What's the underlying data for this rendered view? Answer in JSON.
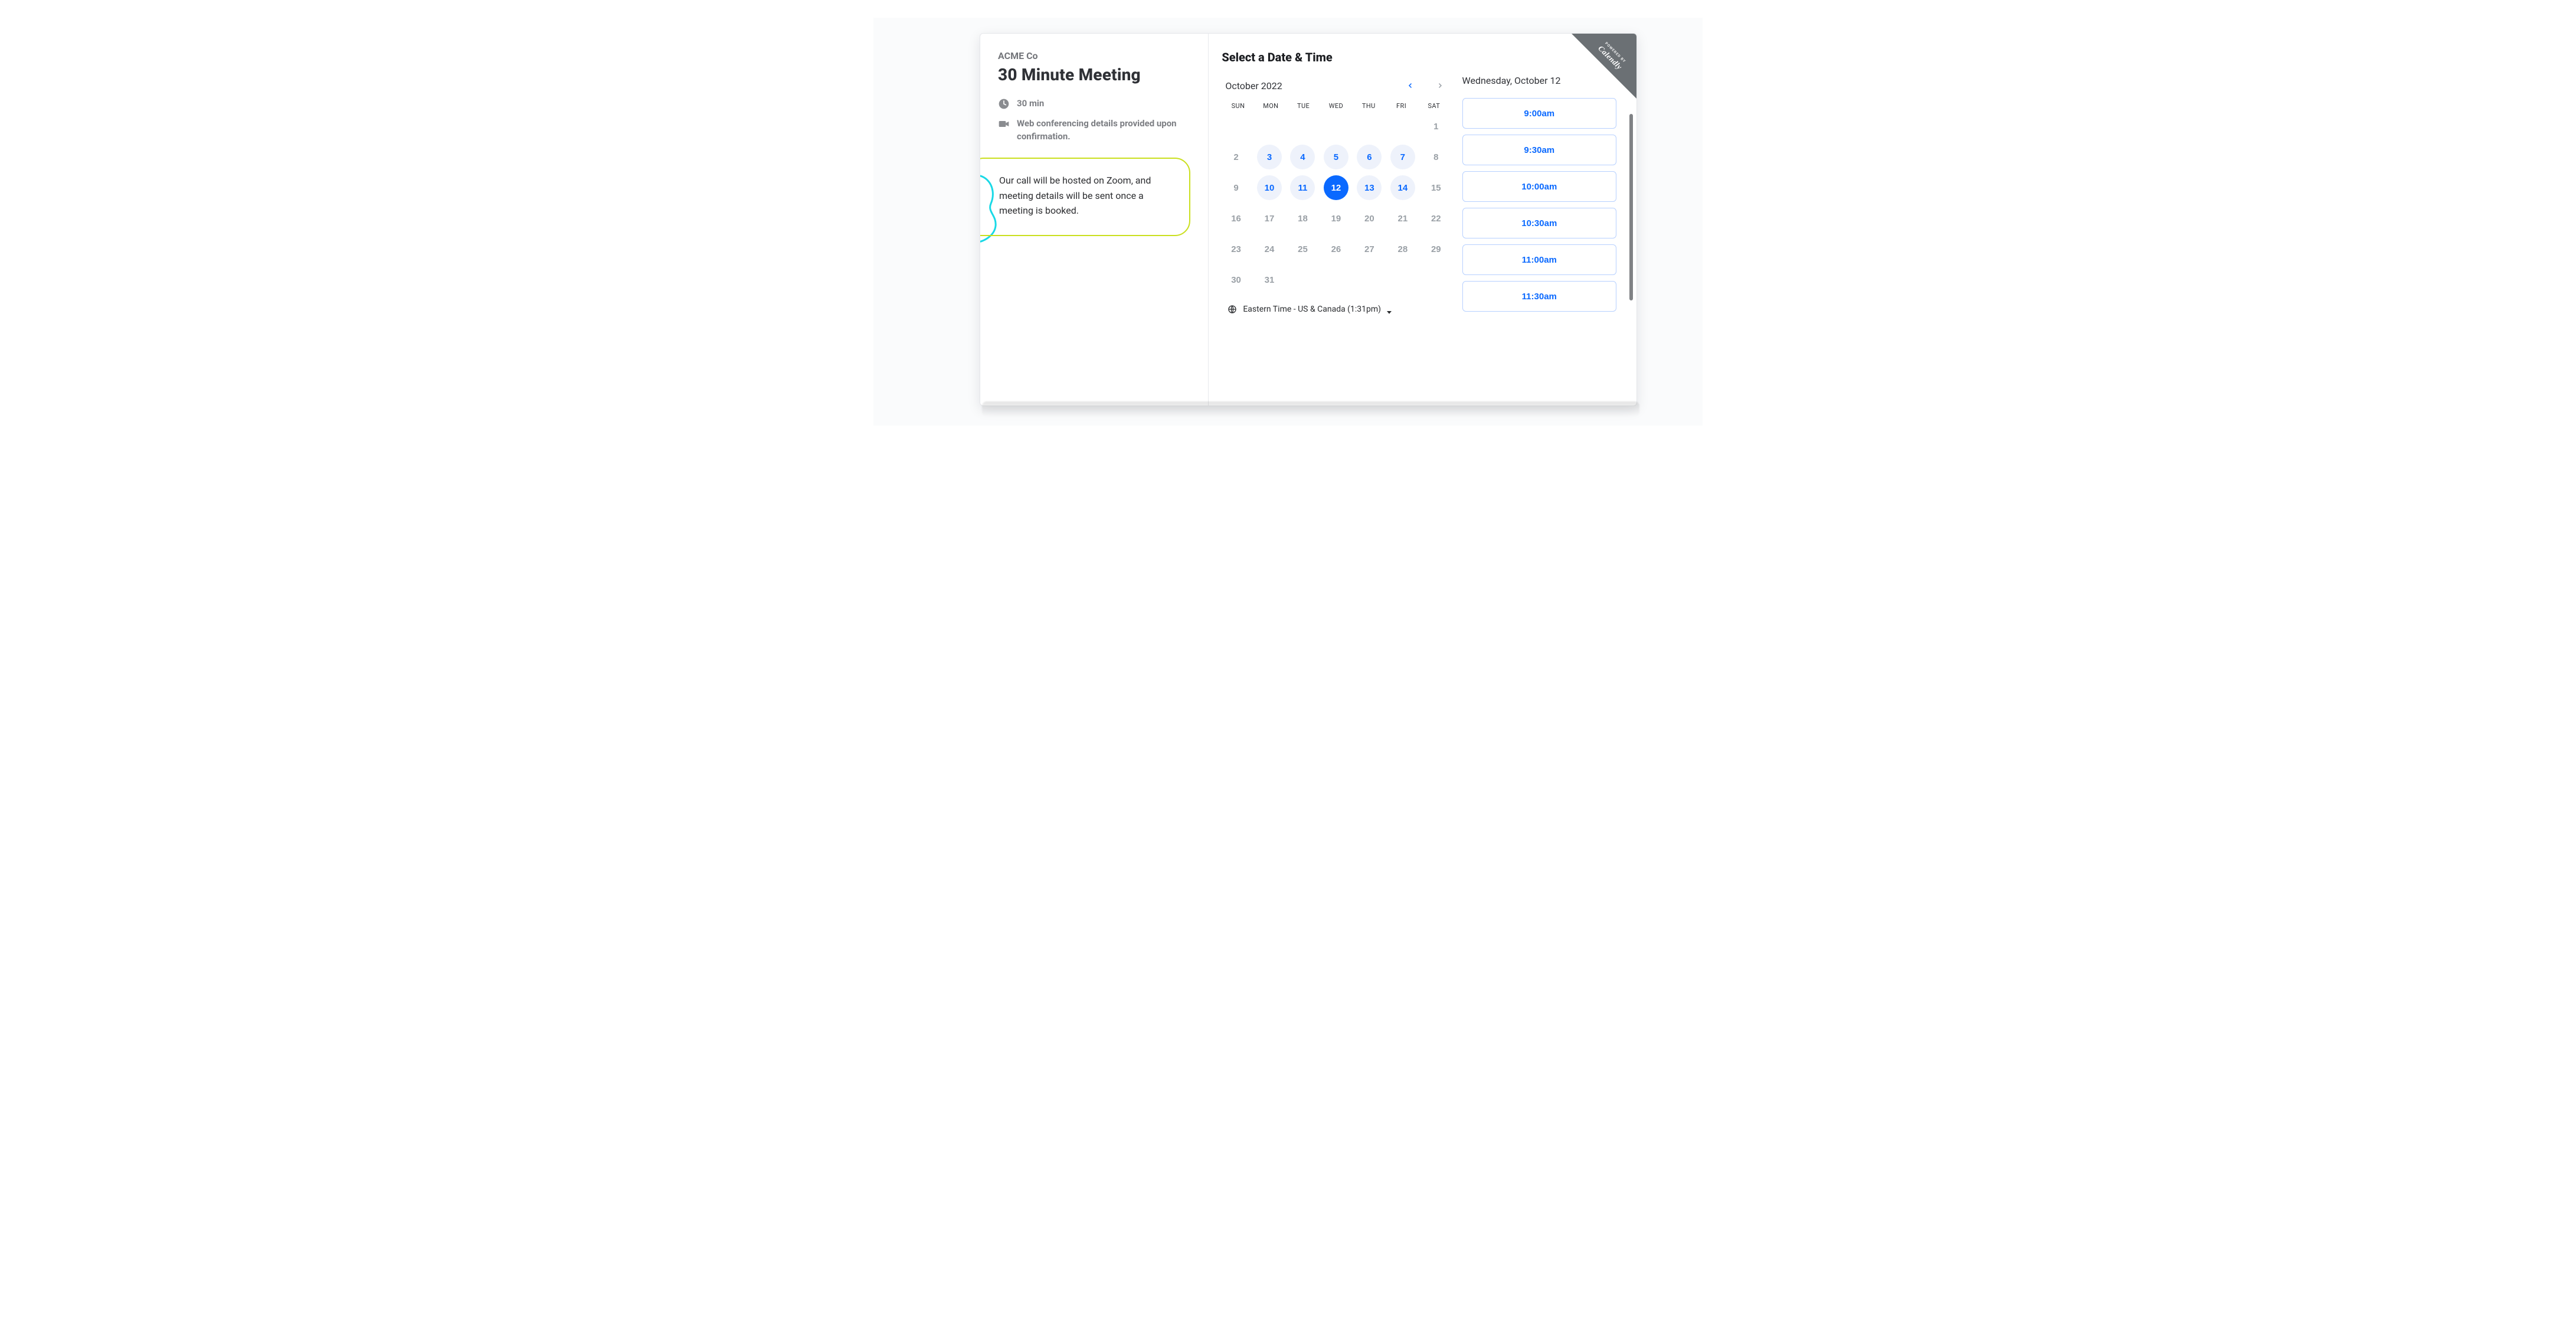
{
  "ribbon": {
    "powered_by": "POWERED BY",
    "brand": "Calendly"
  },
  "left": {
    "org": "ACME Co",
    "title": "30 Minute Meeting",
    "duration": "30 min",
    "conf_note": "Web conferencing details provided upon confirmation.",
    "description": "Our call will be hosted on Zoom, and meeting details will be sent once a meeting is booked."
  },
  "calendar": {
    "select_title": "Select a Date & Time",
    "month_label": "October 2022",
    "dow": [
      "SUN",
      "MON",
      "TUE",
      "WED",
      "THU",
      "FRI",
      "SAT"
    ],
    "leading_blanks": 6,
    "days": [
      {
        "n": 1,
        "state": "muted"
      },
      {
        "n": 2,
        "state": "muted"
      },
      {
        "n": 3,
        "state": "avail"
      },
      {
        "n": 4,
        "state": "avail"
      },
      {
        "n": 5,
        "state": "avail"
      },
      {
        "n": 6,
        "state": "avail"
      },
      {
        "n": 7,
        "state": "avail"
      },
      {
        "n": 8,
        "state": "muted"
      },
      {
        "n": 9,
        "state": "muted"
      },
      {
        "n": 10,
        "state": "avail"
      },
      {
        "n": 11,
        "state": "avail"
      },
      {
        "n": 12,
        "state": "selected"
      },
      {
        "n": 13,
        "state": "avail"
      },
      {
        "n": 14,
        "state": "avail"
      },
      {
        "n": 15,
        "state": "muted"
      },
      {
        "n": 16,
        "state": "muted"
      },
      {
        "n": 17,
        "state": "muted"
      },
      {
        "n": 18,
        "state": "muted"
      },
      {
        "n": 19,
        "state": "muted"
      },
      {
        "n": 20,
        "state": "muted"
      },
      {
        "n": 21,
        "state": "muted"
      },
      {
        "n": 22,
        "state": "muted"
      },
      {
        "n": 23,
        "state": "muted"
      },
      {
        "n": 24,
        "state": "muted"
      },
      {
        "n": 25,
        "state": "muted"
      },
      {
        "n": 26,
        "state": "muted"
      },
      {
        "n": 27,
        "state": "muted"
      },
      {
        "n": 28,
        "state": "muted"
      },
      {
        "n": 29,
        "state": "muted"
      },
      {
        "n": 30,
        "state": "muted"
      },
      {
        "n": 31,
        "state": "muted"
      }
    ],
    "timezone_label": "Eastern Time - US & Canada (1:31pm)"
  },
  "right": {
    "selected_date_label": "Wednesday, October 12",
    "slots": [
      "9:00am",
      "9:30am",
      "10:00am",
      "10:30am",
      "11:00am",
      "11:30am"
    ]
  },
  "colors": {
    "accent": "#0a69ff",
    "avail_bg": "#eef2fb",
    "ribbon": "#6b7074",
    "highlight_border": "#cadf1f",
    "deco_green": "#21cf72",
    "deco_cyan": "#19d9e6"
  }
}
